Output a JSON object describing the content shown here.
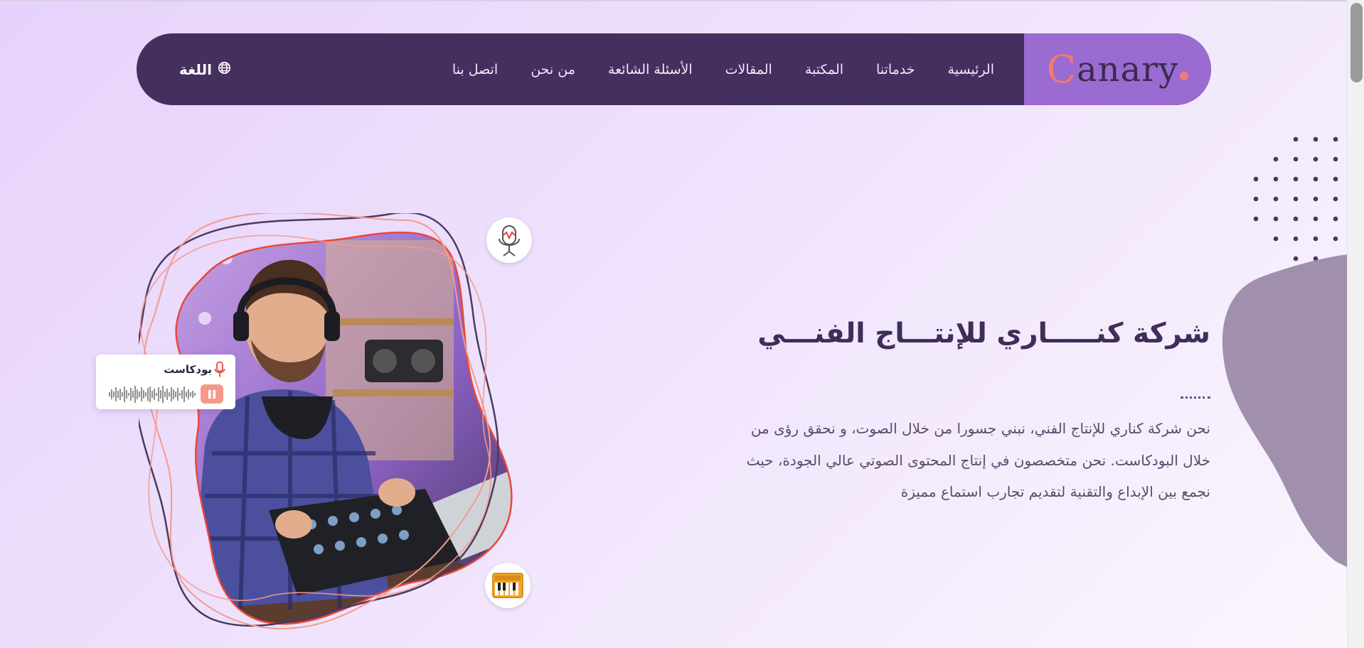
{
  "brand": {
    "logo_text": "anary",
    "logo_initial": "C"
  },
  "nav": {
    "items": [
      {
        "label": "الرئيسية"
      },
      {
        "label": "خدماتنا"
      },
      {
        "label": "المكتبة"
      },
      {
        "label": "المقالات"
      },
      {
        "label": "الأسئلة الشائعة"
      },
      {
        "label": "من نحن"
      },
      {
        "label": "اتصل بنا"
      }
    ],
    "language_label": "اللغة",
    "language_icon": "globe-icon"
  },
  "hero": {
    "title": "شركة كنـــــاري للإنتـــاج الفنـــي",
    "description": "نحن شركة كناري للإنتاج الفني، نبني جسورا من خلال الصوت، و نحقق رؤى من خلال البودكاست. نحن متخصصون في إنتاج المحتوى الصوتي عالي الجودة، حيث نجمع بين الإبداع والتقنية لتقديم تجارب استماع مميزة"
  },
  "podcast_card": {
    "label": "بودكاست",
    "icon": "microphone-icon",
    "control": "pause-icon"
  },
  "badges": {
    "top": "microphone-icon",
    "bottom": "keyboard-icon"
  },
  "colors": {
    "nav_background": "#452f5f",
    "logo_background": "#9a6bd0",
    "accent": "#f07b6e",
    "title": "#3f2d5a",
    "body_text": "#5b4a6e"
  }
}
